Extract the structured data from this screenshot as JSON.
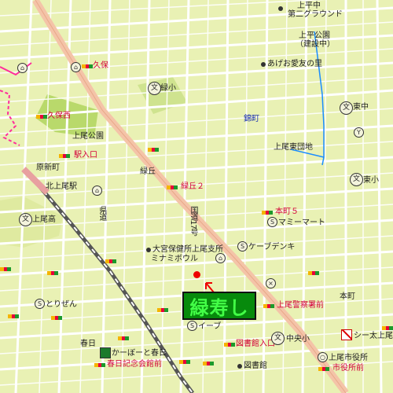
{
  "map": {
    "title": "",
    "colors": {
      "land": "#e9f1b4",
      "road": "#ffffff",
      "main_road": "#ffffff",
      "national_route": "#f4c4a8",
      "park": "#b9d96b",
      "railway": "#555555",
      "river": "#1a8cff",
      "prefecture_border": "#ff2d9b",
      "highlight_bg": "#078a0c",
      "highlight_text": "#43ff47"
    },
    "highlight": {
      "label": "緑寿し",
      "marker_color": "#ee0000"
    },
    "bus_stops": [
      "久保",
      "久保西",
      "駅入口",
      "緑丘２",
      "本町５",
      "上尾警察署前",
      "図書館入口",
      "春日記念会館前",
      "市役所前"
    ],
    "stations": [
      "北上尾駅"
    ],
    "places": {
      "ueno_park": "上平公園",
      "ueno_park_sub": "（建設中）",
      "kamidaira_ground": "上平中",
      "kamidaira_ground2": "第二グラウンド",
      "akebono": "あげお愛友の里",
      "gr_sho": "緑小",
      "higashi_chu": "東中",
      "nishiki": "錦町",
      "agueo_higashi": "上尾東団地",
      "kaminishi": "上尾公園",
      "shin_machi": "原新町",
      "kita_station": "北上尾駅",
      "kita_high": "上尾高",
      "ryokuoka": "緑丘",
      "kenminami": "県",
      "yamato": "大宮保健所上尾支所",
      "minami_bowl": "ミナミボウル",
      "gasden": "ケーブデンキ",
      "ueo_sq": "マミーマート",
      "torizen": "とりぜん",
      "kasuga": "春日",
      "kasuga_park": "かーぼーと春日",
      "iizu": "イーブ",
      "tosho": "図書館",
      "central": "中央小",
      "shiyakusho": "上尾市役所",
      "keisatsu": "シー太上尾",
      "honmachi": "本町",
      "east_small": "東小",
      "city_hall_river": "市",
      "kyosai": "中",
      "route17": "国道17号",
      "route_kita": "県道"
    }
  }
}
